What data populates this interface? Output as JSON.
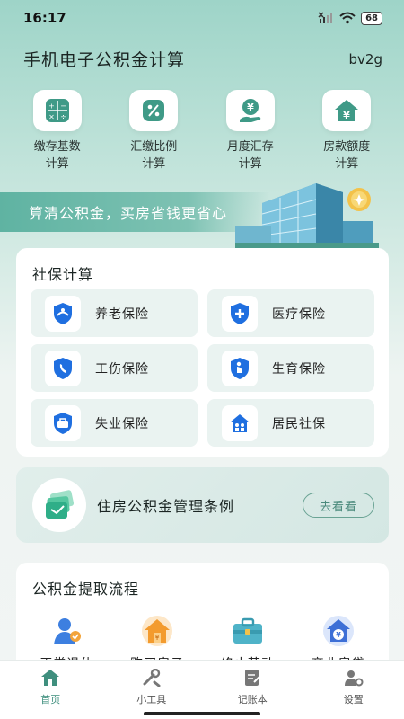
{
  "status_bar": {
    "time": "16:17",
    "battery": "68"
  },
  "header": {
    "title": "手机电子公积金计算",
    "code": "bv2g"
  },
  "tools": [
    {
      "line1": "缴存基数",
      "line2": "计算",
      "icon": "calculator-icon"
    },
    {
      "line1": "汇缴比例",
      "line2": "计算",
      "icon": "percent-icon"
    },
    {
      "line1": "月度汇存",
      "line2": "计算",
      "icon": "yen-hand-icon"
    },
    {
      "line1": "房款额度",
      "line2": "计算",
      "icon": "house-yen-icon"
    }
  ],
  "slogan": "算清公积金，买房省钱更省心",
  "social": {
    "title": "社保计算",
    "items": [
      {
        "label": "养老保险",
        "icon": "pension-icon"
      },
      {
        "label": "医疗保险",
        "icon": "medical-icon"
      },
      {
        "label": "工伤保险",
        "icon": "injury-icon"
      },
      {
        "label": "生育保险",
        "icon": "maternity-icon"
      },
      {
        "label": "失业保险",
        "icon": "unemployment-icon"
      },
      {
        "label": "居民社保",
        "icon": "resident-icon"
      }
    ]
  },
  "regulation": {
    "title": "住房公积金管理条例",
    "button": "去看看"
  },
  "withdraw": {
    "title": "公积金提取流程",
    "items": [
      {
        "label": "正常退休",
        "icon": "retire-icon"
      },
      {
        "label": "购买房子",
        "icon": "buy-house-icon"
      },
      {
        "label": "终止劳动",
        "icon": "terminate-icon"
      },
      {
        "label": "商业房贷",
        "icon": "loan-icon"
      }
    ]
  },
  "tabs": [
    {
      "label": "首页",
      "icon": "home-icon"
    },
    {
      "label": "小工具",
      "icon": "tools-icon"
    },
    {
      "label": "记账本",
      "icon": "notebook-icon"
    },
    {
      "label": "设置",
      "icon": "settings-icon"
    }
  ],
  "colors": {
    "accent": "#3f8f7e",
    "shield": "#1f6fe0",
    "header_bg": "#9ed4c8"
  }
}
